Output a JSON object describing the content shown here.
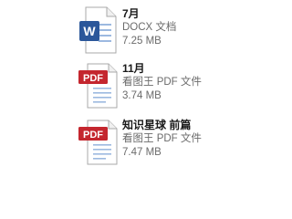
{
  "files": [
    {
      "name": "7月",
      "type": "DOCX 文档",
      "size": "7.25 MB",
      "icon": "word-document-icon",
      "icon_label": "W",
      "icon_color": "#2b579a"
    },
    {
      "name": "11月",
      "type": "看图王 PDF 文件",
      "size": "3.74 MB",
      "icon": "pdf-document-icon",
      "icon_label": "PDF",
      "icon_color": "#c4262e"
    },
    {
      "name": "知识星球 前篇",
      "type": "看图王 PDF 文件",
      "size": "7.47 MB",
      "icon": "pdf-document-icon",
      "icon_label": "PDF",
      "icon_color": "#c4262e"
    }
  ]
}
